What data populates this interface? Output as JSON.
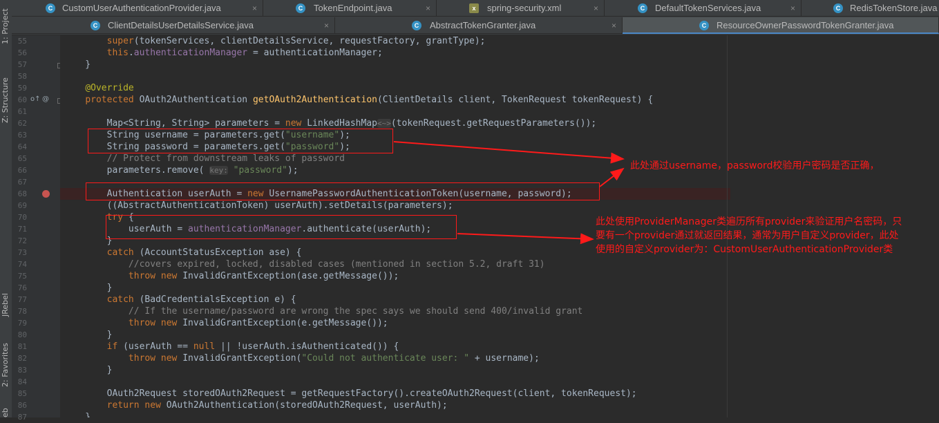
{
  "sidebar": {
    "tools": [
      {
        "label": "1: Project"
      },
      {
        "label": "Z: Structure"
      },
      {
        "label": "JRebel"
      },
      {
        "label": "2: Favorites"
      },
      {
        "label": "eb"
      }
    ]
  },
  "tabs": {
    "row1": [
      {
        "label": "CustomUserAuthenticationProvider.java",
        "icon": "class-icon"
      },
      {
        "label": "TokenEndpoint.java",
        "icon": "class-icon"
      },
      {
        "label": "spring-security.xml",
        "icon": "xml-file-icon"
      },
      {
        "label": "DefaultTokenServices.java",
        "icon": "class-icon"
      },
      {
        "label": "RedisTokenStore.java",
        "icon": "class-icon"
      }
    ],
    "row2": [
      {
        "label": "ClientDetailsUserDetailsService.java",
        "icon": "class-icon"
      },
      {
        "label": "AbstractTokenGranter.java",
        "icon": "class-icon"
      },
      {
        "label": "ResourceOwnerPasswordTokenGranter.java",
        "icon": "class-icon",
        "active": true
      }
    ],
    "close_glyph": "×"
  },
  "code": {
    "lines": [
      {
        "num": "55",
        "segs": [
          [
            "",
            "        "
          ],
          [
            "kw",
            "super"
          ],
          [
            "",
            "(tokenServices, clientDetailsService, requestFactory, grantType);"
          ]
        ]
      },
      {
        "num": "56",
        "segs": [
          [
            "",
            "        "
          ],
          [
            "kw",
            "this"
          ],
          [
            "",
            "."
          ],
          [
            "fld",
            "authenticationManager"
          ],
          [
            "",
            " = authenticationManager;"
          ]
        ]
      },
      {
        "num": "57",
        "segs": [
          [
            "",
            "    }"
          ]
        ]
      },
      {
        "num": "58",
        "segs": [
          [
            "",
            ""
          ]
        ]
      },
      {
        "num": "59",
        "segs": [
          [
            "",
            "    "
          ],
          [
            "an",
            "@Override"
          ]
        ]
      },
      {
        "num": "60",
        "segs": [
          [
            "",
            "    "
          ],
          [
            "kw",
            "protected "
          ],
          [
            "",
            "OAuth2Authentication "
          ],
          [
            "fn",
            "getOAuth2Authentication"
          ],
          [
            "",
            "(ClientDetails client, TokenRequest tokenRequest) {"
          ]
        ]
      },
      {
        "num": "61",
        "segs": [
          [
            "",
            ""
          ]
        ]
      },
      {
        "num": "62",
        "segs": [
          [
            "",
            "        Map<String, String> parameters = "
          ],
          [
            "kw",
            "new "
          ],
          [
            "",
            "LinkedHashMap"
          ],
          [
            "hint",
            "<~>"
          ],
          [
            "",
            "(tokenRequest.getRequestParameters());"
          ]
        ]
      },
      {
        "num": "63",
        "segs": [
          [
            "",
            "        String username = parameters.get("
          ],
          [
            "st",
            "\"username\""
          ],
          [
            "",
            ");"
          ]
        ]
      },
      {
        "num": "64",
        "segs": [
          [
            "",
            "        String password = parameters.get("
          ],
          [
            "st",
            "\"password\""
          ],
          [
            "",
            ");"
          ]
        ]
      },
      {
        "num": "65",
        "segs": [
          [
            "cm",
            "        // Protect from downstream leaks of password"
          ]
        ]
      },
      {
        "num": "66",
        "segs": [
          [
            "",
            "        parameters.remove( "
          ],
          [
            "hint",
            "key:"
          ],
          [
            "",
            " "
          ],
          [
            "st",
            "\"password\""
          ],
          [
            "",
            ");"
          ]
        ]
      },
      {
        "num": "67",
        "segs": [
          [
            "",
            ""
          ]
        ]
      },
      {
        "num": "68",
        "segs": [
          [
            "",
            "        Authentication userAuth = "
          ],
          [
            "kw",
            "new "
          ],
          [
            "",
            "UsernamePasswordAuthenticationToken(username, password);"
          ]
        ]
      },
      {
        "num": "69",
        "segs": [
          [
            "",
            "        ((AbstractAuthenticationToken) userAuth).setDetails(parameters);"
          ]
        ]
      },
      {
        "num": "70",
        "segs": [
          [
            "",
            "        "
          ],
          [
            "kw",
            "try "
          ],
          [
            "",
            "{"
          ]
        ]
      },
      {
        "num": "71",
        "segs": [
          [
            "",
            "            userAuth = "
          ],
          [
            "fld",
            "authenticationManager"
          ],
          [
            "",
            ".authenticate(userAuth);"
          ]
        ]
      },
      {
        "num": "72",
        "segs": [
          [
            "",
            "        }"
          ]
        ]
      },
      {
        "num": "73",
        "segs": [
          [
            "",
            "        "
          ],
          [
            "kw",
            "catch "
          ],
          [
            "",
            "(AccountStatusException ase) {"
          ]
        ]
      },
      {
        "num": "74",
        "segs": [
          [
            "cm",
            "            //covers expired, locked, disabled cases (mentioned in section 5.2, draft 31)"
          ]
        ]
      },
      {
        "num": "75",
        "segs": [
          [
            "",
            "            "
          ],
          [
            "kw",
            "throw new "
          ],
          [
            "",
            "InvalidGrantException(ase.getMessage());"
          ]
        ]
      },
      {
        "num": "76",
        "segs": [
          [
            "",
            "        }"
          ]
        ]
      },
      {
        "num": "77",
        "segs": [
          [
            "",
            "        "
          ],
          [
            "kw",
            "catch "
          ],
          [
            "",
            "(BadCredentialsException e) {"
          ]
        ]
      },
      {
        "num": "78",
        "segs": [
          [
            "cm",
            "            // If the username/password are wrong the spec says we should send 400/invalid grant"
          ]
        ]
      },
      {
        "num": "79",
        "segs": [
          [
            "",
            "            "
          ],
          [
            "kw",
            "throw new "
          ],
          [
            "",
            "InvalidGrantException(e.getMessage());"
          ]
        ]
      },
      {
        "num": "80",
        "segs": [
          [
            "",
            "        }"
          ]
        ]
      },
      {
        "num": "81",
        "segs": [
          [
            "",
            "        "
          ],
          [
            "kw",
            "if "
          ],
          [
            "",
            "(userAuth == "
          ],
          [
            "kw",
            "null "
          ],
          [
            "",
            "|| !userAuth.isAuthenticated()) {"
          ]
        ]
      },
      {
        "num": "82",
        "segs": [
          [
            "",
            "            "
          ],
          [
            "kw",
            "throw new "
          ],
          [
            "",
            "InvalidGrantException("
          ],
          [
            "st",
            "\"Could not authenticate user: \""
          ],
          [
            "",
            " + username);"
          ]
        ]
      },
      {
        "num": "83",
        "segs": [
          [
            "",
            "        }"
          ]
        ]
      },
      {
        "num": "84",
        "segs": [
          [
            "",
            ""
          ]
        ]
      },
      {
        "num": "85",
        "segs": [
          [
            "",
            "        OAuth2Request storedOAuth2Request = getRequestFactory().createOAuth2Request(client, tokenRequest);"
          ]
        ]
      },
      {
        "num": "86",
        "segs": [
          [
            "",
            "        "
          ],
          [
            "kw",
            "return new "
          ],
          [
            "",
            "OAuth2Authentication(storedOAuth2Request, userAuth);"
          ]
        ]
      },
      {
        "num": "87",
        "segs": [
          [
            "",
            "    }"
          ]
        ]
      }
    ]
  },
  "annotations": {
    "note1": "此处通过username，password校验用户密码是否正确，",
    "note2_lines": [
      "此处使用ProviderManager类遍历所有provider来验证用户名密码，只",
      "要有一个provider通过就返回结果，通常为用户自定义provider，此处",
      "使用的自定义provider为：CustomUserAuthenticationProvider类"
    ],
    "color": "#ff1a1a"
  },
  "theme": {
    "background": "#2b2b2b",
    "keyword": "#cc7832",
    "string": "#6a8759",
    "comment": "#808080",
    "method": "#ffc66d",
    "annotation": "#bbb529",
    "field": "#9876aa"
  }
}
